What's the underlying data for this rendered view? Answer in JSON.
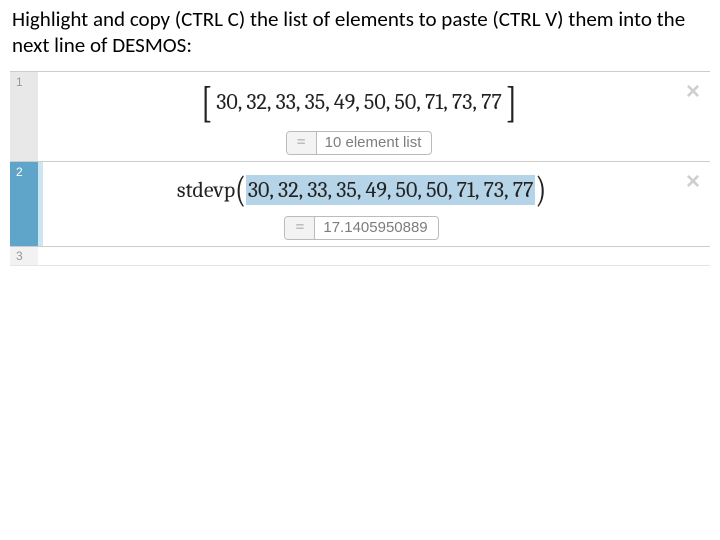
{
  "instruction": "Highlight and copy (CTRL C) the list of elements to paste (CTRL V) them into the next line of DESMOS:",
  "rows": {
    "r1": {
      "num": "1",
      "open": "[",
      "values": " 30, 32, 33, 35, 49, 50, 50, 71, 73, 77 ",
      "close": "]",
      "result": "10 element list",
      "eq": "=",
      "x": "×"
    },
    "r2": {
      "num": "2",
      "func": "stdevp",
      "open": "(",
      "values": " 30, 32, 33, 35, 49, 50, 50, 71, 73, 77 ",
      "close": ")",
      "result": "17.1405950889",
      "eq": "=",
      "x": "×"
    },
    "r3": {
      "num": "3"
    }
  }
}
